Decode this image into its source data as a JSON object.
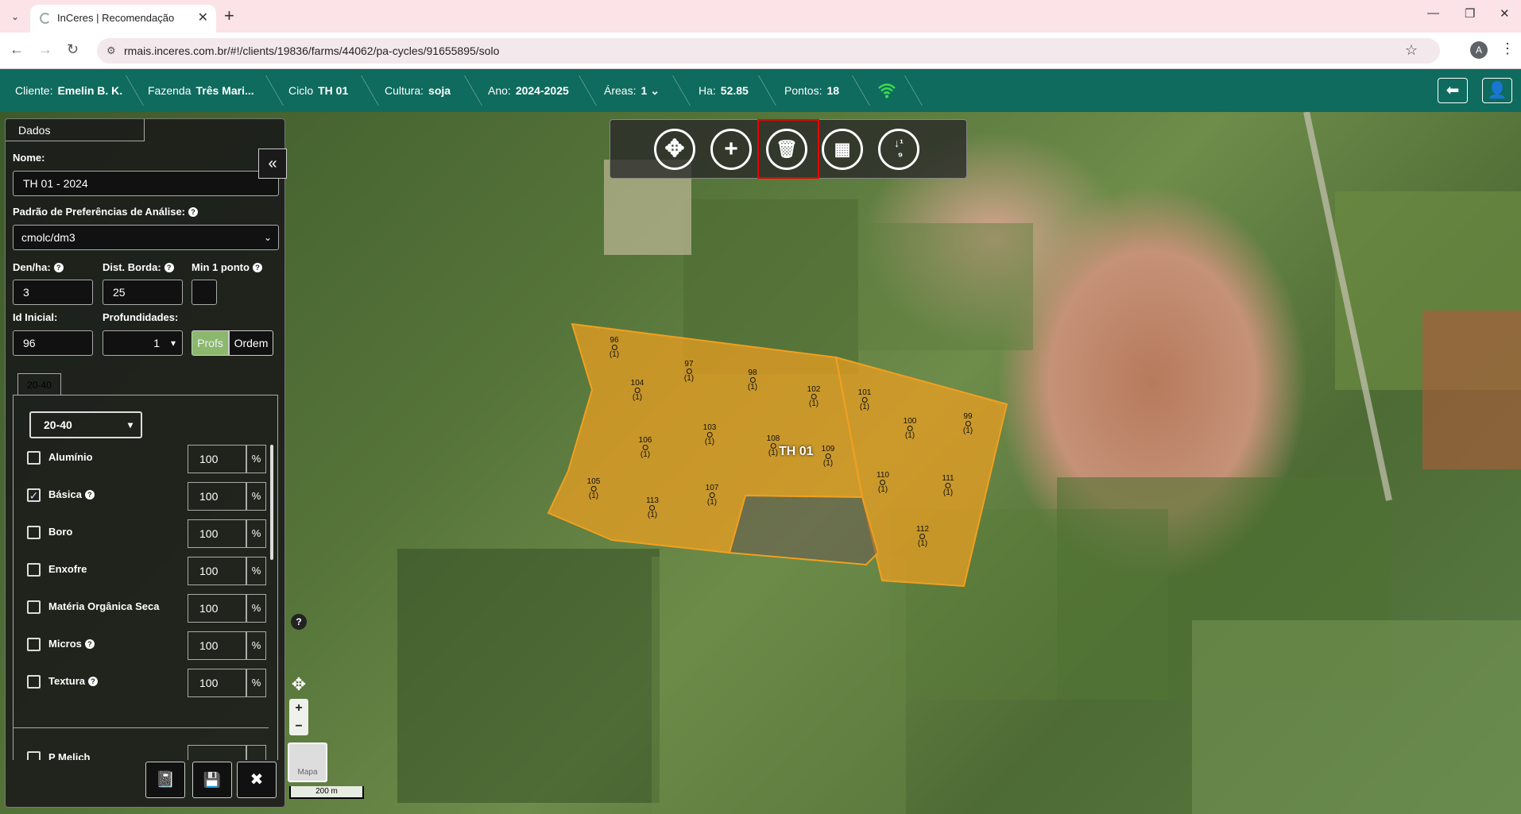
{
  "browser": {
    "tab_title": "InCeres | Recomendação",
    "url": "rmais.inceres.com.br/#!/clients/19836/farms/44062/pa-cycles/91655895/solo",
    "profile_initial": "A"
  },
  "header": {
    "cliente_label": "Cliente:",
    "cliente_value": "Emelin B. K.",
    "fazenda_label": "Fazenda",
    "fazenda_value": "Três Mari...",
    "ciclo_label": "Ciclo",
    "ciclo_value": "TH 01",
    "cultura_label": "Cultura:",
    "cultura_value": "soja",
    "ano_label": "Ano:",
    "ano_value": "2024-2025",
    "areas_label": "Áreas:",
    "areas_value": "1",
    "ha_label": "Ha:",
    "ha_value": "52.85",
    "pontos_label": "Pontos:",
    "pontos_value": "18",
    "status_color": "#3ddc4a"
  },
  "panel": {
    "tab": "Dados",
    "nome_label": "Nome:",
    "nome_value": "TH 01 - 2024",
    "padrao_label": "Padrão de Preferências de Análise:",
    "padrao_value": "cmolc/dm3",
    "denha_label": "Den/ha:",
    "denha_value": "3",
    "dist_label": "Dist. Borda:",
    "dist_value": "25",
    "min_label": "Min 1 ponto",
    "id_label": "Id Inicial:",
    "id_value": "96",
    "prof_label": "Profundidades:",
    "prof_value": "1",
    "profs_btn": "Profs",
    "ordem_btn": "Ordem",
    "depth_tab": "20-40",
    "depth_select": "20-40",
    "nutrients": [
      {
        "label": "Alumínio",
        "checked": false,
        "help": false,
        "value": "100",
        "unit": "%"
      },
      {
        "label": "Básica",
        "checked": true,
        "help": true,
        "value": "100",
        "unit": "%"
      },
      {
        "label": "Boro",
        "checked": false,
        "help": false,
        "value": "100",
        "unit": "%"
      },
      {
        "label": "Enxofre",
        "checked": false,
        "help": false,
        "value": "100",
        "unit": "%"
      },
      {
        "label": "Matéria Orgânica Seca",
        "checked": false,
        "help": false,
        "value": "100",
        "unit": "%"
      },
      {
        "label": "Micros",
        "checked": false,
        "help": true,
        "value": "100",
        "unit": "%"
      },
      {
        "label": "Textura",
        "checked": false,
        "help": true,
        "value": "100",
        "unit": "%"
      }
    ],
    "partial_row": "P Melich"
  },
  "map": {
    "area_label": "TH 01",
    "area_color": "#f0a020",
    "map_type_label": "Mapa",
    "scale_label": "200 m",
    "points": [
      {
        "id": "96",
        "n": "(1)"
      },
      {
        "id": "97",
        "n": "(1)"
      },
      {
        "id": "98",
        "n": "(1)"
      },
      {
        "id": "104",
        "n": "(1)"
      },
      {
        "id": "102",
        "n": "(1)"
      },
      {
        "id": "101",
        "n": "(1)"
      },
      {
        "id": "100",
        "n": "(1)"
      },
      {
        "id": "99",
        "n": "(1)"
      },
      {
        "id": "103",
        "n": "(1)"
      },
      {
        "id": "106",
        "n": "(1)"
      },
      {
        "id": "108",
        "n": "(1)"
      },
      {
        "id": "109",
        "n": "(1)"
      },
      {
        "id": "110",
        "n": "(1)"
      },
      {
        "id": "111",
        "n": "(1)"
      },
      {
        "id": "105",
        "n": "(1)"
      },
      {
        "id": "107",
        "n": "(1)"
      },
      {
        "id": "113",
        "n": "(1)"
      },
      {
        "id": "112",
        "n": "(1)"
      }
    ]
  },
  "icons": [
    "move-icon",
    "add-icon",
    "trash-icon",
    "map-icon",
    "sort-numeric-icon"
  ]
}
